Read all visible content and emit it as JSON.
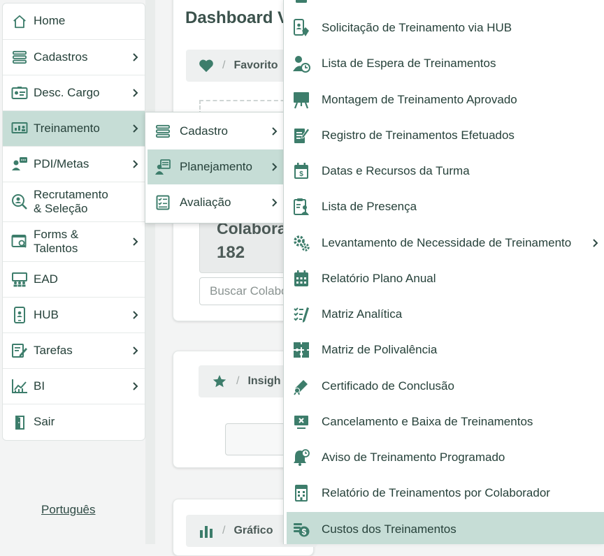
{
  "sidebar": {
    "items": [
      {
        "label": "Home",
        "icon": "home-icon",
        "has_arrow": false
      },
      {
        "label": "Cadastros",
        "icon": "list-icon",
        "has_arrow": true
      },
      {
        "label": "Desc. Cargo",
        "icon": "id-card-icon",
        "has_arrow": true
      },
      {
        "label": "Treinamento",
        "icon": "presentation-icon",
        "has_arrow": true,
        "active": true
      },
      {
        "label": "PDI/Metas",
        "icon": "user-chat-icon",
        "has_arrow": true
      },
      {
        "label": "Recrutamento\n& Seleção",
        "icon": "search-user-icon",
        "has_arrow": false
      },
      {
        "label": "Forms &\nTalentos",
        "icon": "form-search-icon",
        "has_arrow": true
      },
      {
        "label": "EAD",
        "icon": "classroom-icon",
        "has_arrow": false
      },
      {
        "label": "HUB",
        "icon": "phone-icon",
        "has_arrow": true
      },
      {
        "label": "Tarefas",
        "icon": "edit-icon",
        "has_arrow": true
      },
      {
        "label": "BI",
        "icon": "chart-icon",
        "has_arrow": true
      },
      {
        "label": "Sair",
        "icon": "exit-icon",
        "has_arrow": false
      }
    ],
    "language": "Português"
  },
  "background": {
    "dashboard_title": "Dashboard V",
    "favorites_crumb": "Favorito",
    "colaboradores_label": "Colabora",
    "colaboradores_count": "182",
    "search_placeholder": "Buscar Colabo",
    "insights_crumb": "Insigh",
    "graficos_crumb": "Gráfico"
  },
  "submenu_treinamento": {
    "items": [
      {
        "label": "Cadastro",
        "icon": "list-icon"
      },
      {
        "label": "Planejamento",
        "icon": "planning-icon",
        "active": true
      },
      {
        "label": "Avaliação",
        "icon": "checklist-icon"
      }
    ]
  },
  "submenu_planejamento": {
    "items": [
      {
        "label": "Solicitação de Treinamento via HUB",
        "icon": "mobile-request-icon"
      },
      {
        "label": "Lista de Espera de Treinamentos",
        "icon": "user-clock-icon"
      },
      {
        "label": "Montagem de Treinamento Aprovado",
        "icon": "board-icon"
      },
      {
        "label": "Registro de Treinamentos Efetuados",
        "icon": "note-edit-icon"
      },
      {
        "label": "Datas e Recursos da Turma",
        "icon": "calendar-money-icon"
      },
      {
        "label": "Lista de Presença",
        "icon": "clipboard-user-icon"
      },
      {
        "label": "Levantamento de Necessidade de Treinamento",
        "icon": "gears-icon",
        "has_arrow": true
      },
      {
        "label": "Relatório Plano Anual",
        "icon": "calendar-grid-icon"
      },
      {
        "label": "Matriz Analítica",
        "icon": "checklist-pen-icon"
      },
      {
        "label": "Matriz de Polivalência",
        "icon": "puzzle-icon"
      },
      {
        "label": "Certificado de Conclusão",
        "icon": "diploma-icon"
      },
      {
        "label": "Cancelamento e Baixa de Treinamentos",
        "icon": "screen-cancel-icon"
      },
      {
        "label": "Aviso de Treinamento Programado",
        "icon": "bell-clock-icon"
      },
      {
        "label": "Relatório de Treinamentos por Colaborador",
        "icon": "building-report-icon"
      },
      {
        "label": "Custos dos Treinamentos",
        "icon": "coins-icon",
        "active": true
      }
    ]
  },
  "colors": {
    "accent": "#3d7d6b",
    "active_bg": "#c6ddd6",
    "text": "#26413a"
  }
}
